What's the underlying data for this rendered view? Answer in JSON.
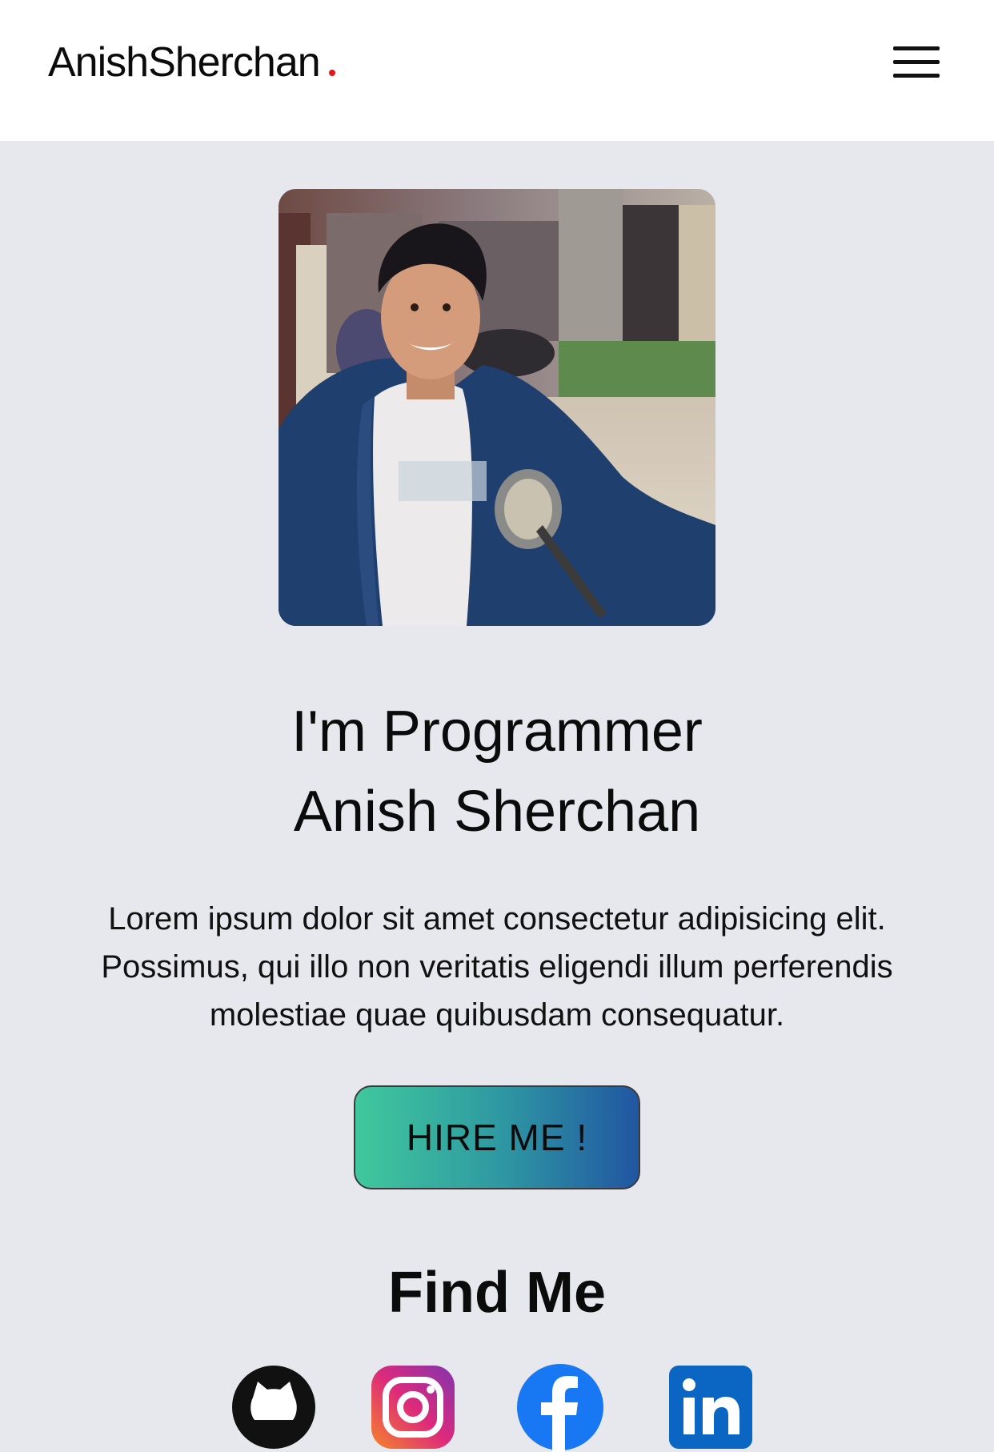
{
  "navbar": {
    "brand": "AnishSherchan",
    "brand_dot_color": "#e41818",
    "menu_icon": "hamburger-menu-icon"
  },
  "hero": {
    "photo_icon": "profile-photo",
    "headline_line1": "I'm Programmer",
    "headline_line2": "Anish Sherchan",
    "intro": "Lorem ipsum dolor sit amet consectetur adipisicing elit. Possimus, qui illo non veritatis eligendi illum perferendis molestiae quae quibusdam consequatur.",
    "hire_button": "HIRE ME !",
    "hire_gradient": [
      "#40c89c",
      "#2156a2"
    ]
  },
  "find_me": {
    "title": "Find Me",
    "links": [
      {
        "name": "github",
        "icon": "github-icon",
        "color": "#111111"
      },
      {
        "name": "instagram",
        "icon": "instagram-icon",
        "color": "#c13584"
      },
      {
        "name": "facebook",
        "icon": "facebook-icon",
        "color": "#1877f2"
      },
      {
        "name": "linkedin",
        "icon": "linkedin-icon",
        "color": "#0a66c2"
      }
    ]
  },
  "colors": {
    "page_background": "#e6e8ee",
    "navbar_background": "#ffffff",
    "text": "#0b0b0b"
  }
}
